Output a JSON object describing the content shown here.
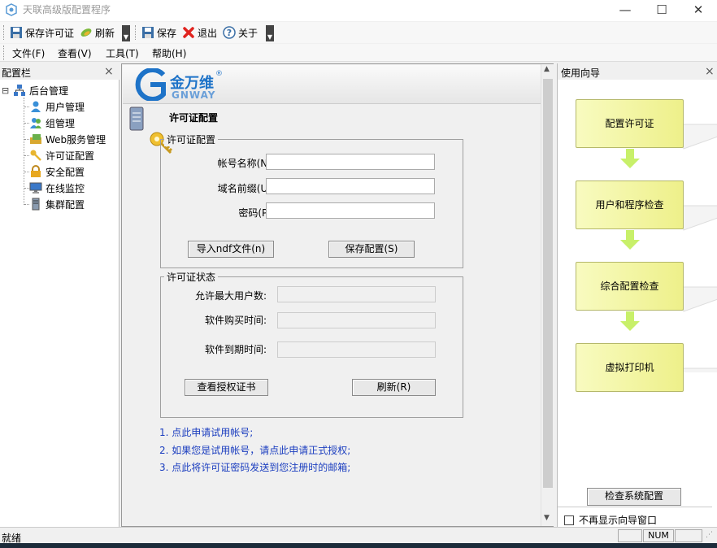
{
  "window": {
    "title": "天联高级版配置程序",
    "min_symbol": "—",
    "max_symbol": "☐",
    "close_symbol": "✕"
  },
  "toolbar": {
    "save_license": "保存许可证",
    "refresh": "刷新",
    "save": "保存",
    "exit": "退出",
    "about": "关于"
  },
  "menu": [
    "文件(F)",
    "查看(V)",
    "工具(T)",
    "帮助(H)"
  ],
  "left_panel": {
    "title": "配置栏",
    "close": "×",
    "root": "后台管理",
    "expand_symbol": "⊟",
    "items": [
      "用户管理",
      "组管理",
      "Web服务管理",
      "许可证配置",
      "安全配置",
      "在线监控",
      "集群配置"
    ]
  },
  "center": {
    "logo_cn": "金万维",
    "logo_en": "GNWAY",
    "logo_mark": "®",
    "page_title": "许可证配置",
    "config_group": {
      "legend": "许可证配置",
      "account_label": "帐号名称(N):",
      "domain_label": "域名前缀(U):",
      "password_label": "密码(P):",
      "account_value": "",
      "domain_value": "",
      "password_value": "",
      "import_button": "导入ndf文件(n)",
      "save_button": "保存配置(S)"
    },
    "status_group": {
      "legend": "许可证状态",
      "max_users_label": "允许最大用户数:",
      "purchase_label": "软件购买时间:",
      "expire_label": "软件到期时间:",
      "max_users_value": "",
      "purchase_value": "",
      "expire_value": "",
      "view_cert_button": "查看授权证书",
      "refresh_button": "刷新(R)"
    },
    "links": [
      "1. 点此申请试用帐号;",
      "2. 如果您是试用帐号，请点此申请正式授权;",
      "3. 点此将许可证密码发送到您注册时的邮箱;"
    ]
  },
  "right_panel": {
    "title": "使用向导",
    "close": "×",
    "steps": [
      "配置许可证",
      "用户和程序检查",
      "综合配置检查",
      "虚拟打印机"
    ],
    "check_button": "检查系统配置",
    "dont_show": "不再显示向导窗口"
  },
  "status_bar": {
    "text": "就绪",
    "num": "NUM"
  },
  "colors": {
    "link": "#1a3dbf",
    "step_fill": "#f3f5a8",
    "arrow": "#c8f06a",
    "logo_blue": "#1e73c8"
  }
}
